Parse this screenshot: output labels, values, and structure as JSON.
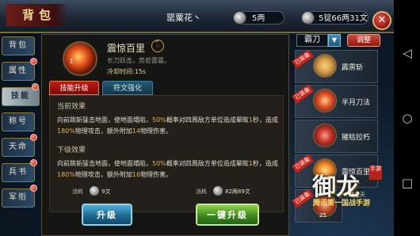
{
  "header": {
    "title": "背包",
    "player_name": "罂粟花丶",
    "currency_silver": "5两",
    "currency_gold": "5锭66两31文",
    "close_label": "✕"
  },
  "sidebar": {
    "tabs": [
      {
        "label": "背包",
        "badge": false
      },
      {
        "label": "属性",
        "badge": true
      },
      {
        "label": "技能",
        "badge": true,
        "active": true
      },
      {
        "label": "称号",
        "badge": false
      },
      {
        "label": "天命",
        "badge": true
      },
      {
        "label": "兵书",
        "badge": true
      },
      {
        "label": "军衔",
        "badge": true
      }
    ]
  },
  "skill": {
    "name": "震惊百里",
    "level_icon": "1",
    "badge_glyph": "ꪸ",
    "description": "长刀跃击，势若雷霆。",
    "cooldown": "冷却时间:15s",
    "tabs": {
      "upgrade": "技能升级",
      "rune": "符文强化"
    },
    "current_effect_title": "当前效果",
    "current_effect": {
      "p1": "向前跳斩猛击地面，使地面塌陷，",
      "h1": "50%",
      "p2": "概率对四周敌方单位造成晕眩",
      "h2": "1",
      "p3": "秒，造成",
      "h3": "180%",
      "p4": "物理攻击，额外附加",
      "h4": "14",
      "p5": "物理伤害。"
    },
    "next_effect_title": "下级效果",
    "next_effect": {
      "p1": "向前跳斩猛击地面，使地面塌陷，",
      "h1": "50%",
      "p2": "概率对四周敌方单位造成晕眩",
      "h2": "1",
      "p3": "秒，造成",
      "h3": "180%",
      "p4": "物理攻击，额外附加",
      "h4": "16",
      "p5": "物理伤害。"
    },
    "cost_left_label": "消耗",
    "cost_left_value": "9文",
    "cost_right_label": "消耗",
    "cost_right_value": "82两89文",
    "upgrade_button": "升级",
    "one_key_button": "一键升级"
  },
  "right_panel": {
    "weapon": "霸刀",
    "dropdown_glyph": "▼",
    "adjust_button": "调整",
    "slots": [
      {
        "name": "霹雳斩",
        "equipped": "已装备",
        "color": "#d9a04a"
      },
      {
        "name": "半月刀法",
        "equipped": "已装备",
        "color": "#e2542a"
      },
      {
        "name": "摧枯拉朽",
        "equipped": "",
        "color": "#c8382a"
      },
      {
        "name": "震惊百里",
        "equipped": "已装备",
        "color": "#f28a2a"
      },
      {
        "name": "",
        "equipped": "已装备",
        "color": "#b94a2a"
      }
    ]
  },
  "logo": {
    "big": "御龙",
    "brand": "腾讯第一国战手游",
    "sub": "龍在天",
    "seal": "手游",
    "version": "25"
  },
  "android_nav": {
    "back": "◁",
    "home": "○",
    "recent": "□"
  }
}
